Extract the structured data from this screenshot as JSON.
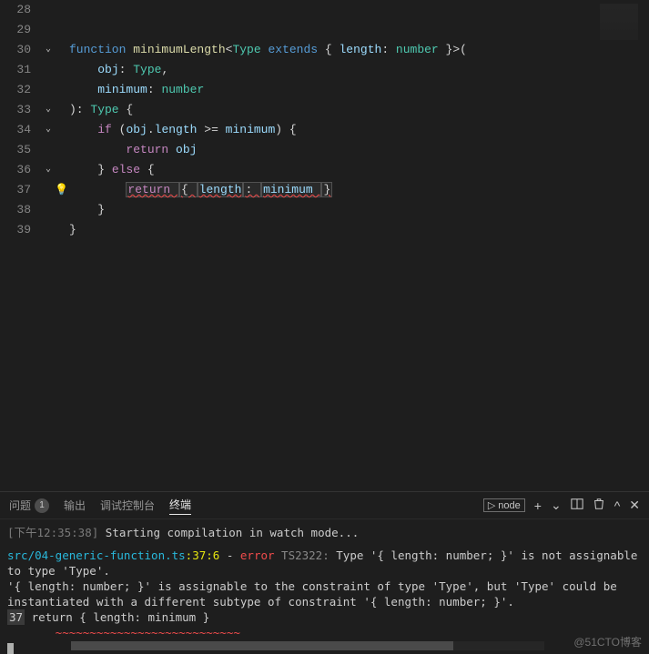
{
  "lines": [
    {
      "n": 28,
      "fold": "",
      "bulb": false,
      "tokens": []
    },
    {
      "n": 29,
      "fold": "",
      "bulb": false,
      "tokens": []
    },
    {
      "n": 30,
      "fold": "v",
      "bulb": false,
      "tokens": [
        {
          "t": "function ",
          "c": "kw"
        },
        {
          "t": "minimumLength",
          "c": "fn"
        },
        {
          "t": "<",
          "c": "punct"
        },
        {
          "t": "Type ",
          "c": "type"
        },
        {
          "t": "extends ",
          "c": "kw"
        },
        {
          "t": "{ ",
          "c": "punct"
        },
        {
          "t": "length",
          "c": "prop"
        },
        {
          "t": ": ",
          "c": "punct"
        },
        {
          "t": "number ",
          "c": "num"
        },
        {
          "t": "}>(",
          "c": "punct"
        }
      ]
    },
    {
      "n": 31,
      "fold": "",
      "bulb": false,
      "tokens": [
        {
          "t": "    ",
          "c": ""
        },
        {
          "t": "obj",
          "c": "prop"
        },
        {
          "t": ": ",
          "c": "punct"
        },
        {
          "t": "Type",
          "c": "type"
        },
        {
          "t": ",",
          "c": "punct"
        }
      ]
    },
    {
      "n": 32,
      "fold": "",
      "bulb": false,
      "tokens": [
        {
          "t": "    ",
          "c": ""
        },
        {
          "t": "minimum",
          "c": "prop"
        },
        {
          "t": ": ",
          "c": "punct"
        },
        {
          "t": "number",
          "c": "num"
        }
      ]
    },
    {
      "n": 33,
      "fold": "v",
      "bulb": false,
      "tokens": [
        {
          "t": "): ",
          "c": "punct"
        },
        {
          "t": "Type ",
          "c": "type"
        },
        {
          "t": "{",
          "c": "punct"
        }
      ]
    },
    {
      "n": 34,
      "fold": "v",
      "bulb": false,
      "tokens": [
        {
          "t": "    ",
          "c": ""
        },
        {
          "t": "if ",
          "c": "ctrl"
        },
        {
          "t": "(",
          "c": "punct"
        },
        {
          "t": "obj",
          "c": "prop"
        },
        {
          "t": ".",
          "c": "punct"
        },
        {
          "t": "length ",
          "c": "prop"
        },
        {
          "t": ">= ",
          "c": "punct"
        },
        {
          "t": "minimum",
          "c": "prop"
        },
        {
          "t": ") {",
          "c": "punct"
        }
      ]
    },
    {
      "n": 35,
      "fold": "",
      "bulb": false,
      "tokens": [
        {
          "t": "        ",
          "c": ""
        },
        {
          "t": "return ",
          "c": "ctrl"
        },
        {
          "t": "obj",
          "c": "prop"
        }
      ]
    },
    {
      "n": 36,
      "fold": "v",
      "bulb": false,
      "tokens": [
        {
          "t": "    } ",
          "c": "punct"
        },
        {
          "t": "else ",
          "c": "ctrl"
        },
        {
          "t": "{",
          "c": "punct"
        }
      ]
    },
    {
      "n": 37,
      "fold": "",
      "bulb": true,
      "tokens": [
        {
          "t": "        ",
          "c": ""
        },
        {
          "t": "return ",
          "c": "ctrl",
          "err": true,
          "box": true
        },
        {
          "t": "{ ",
          "c": "punct",
          "err": true,
          "box": true
        },
        {
          "t": "length",
          "c": "prop",
          "err": true,
          "box": true
        },
        {
          "t": ": ",
          "c": "punct",
          "err": true,
          "box": true
        },
        {
          "t": "minimum ",
          "c": "prop",
          "err": true,
          "box": true
        },
        {
          "t": "}",
          "c": "punct",
          "err": true,
          "box": true
        }
      ]
    },
    {
      "n": 38,
      "fold": "",
      "bulb": false,
      "tokens": [
        {
          "t": "    }",
          "c": "punct"
        }
      ]
    },
    {
      "n": 39,
      "fold": "",
      "bulb": false,
      "tokens": [
        {
          "t": "}",
          "c": "punct"
        }
      ]
    }
  ],
  "panel": {
    "tabs": {
      "problems": "问题",
      "problems_badge": "1",
      "output": "输出",
      "debug": "调试控制台",
      "terminal": "终端"
    },
    "right": {
      "launcher": "node",
      "plus": "+",
      "split_icon": "split",
      "trash_icon": "trash",
      "maximize_icon": "maximize",
      "close_icon": "close"
    }
  },
  "terminal": {
    "ts": "[下午12:35:38]",
    "msg1": " Starting compilation in watch mode...",
    "file": "src/04-generic-function.ts",
    "loc": ":37:6",
    "dash": " - ",
    "err": "error",
    "code": " TS2322: ",
    "m1": "Type '{ length: number; }' is not assignable to type 'Type'.",
    "m2": "  '{ length: number; }' is assignable to the constraint of type 'Type', but 'Type' could be instantiated with a different subtype of constraint '{ length: number; }'.",
    "ln_badge": "37",
    "src_line": "       return { length: minimum }",
    "src_under": "       ~~~~~~~~~~~~~~~~~~~~~~~~~~~"
  },
  "watermark": "@51CTO博客"
}
